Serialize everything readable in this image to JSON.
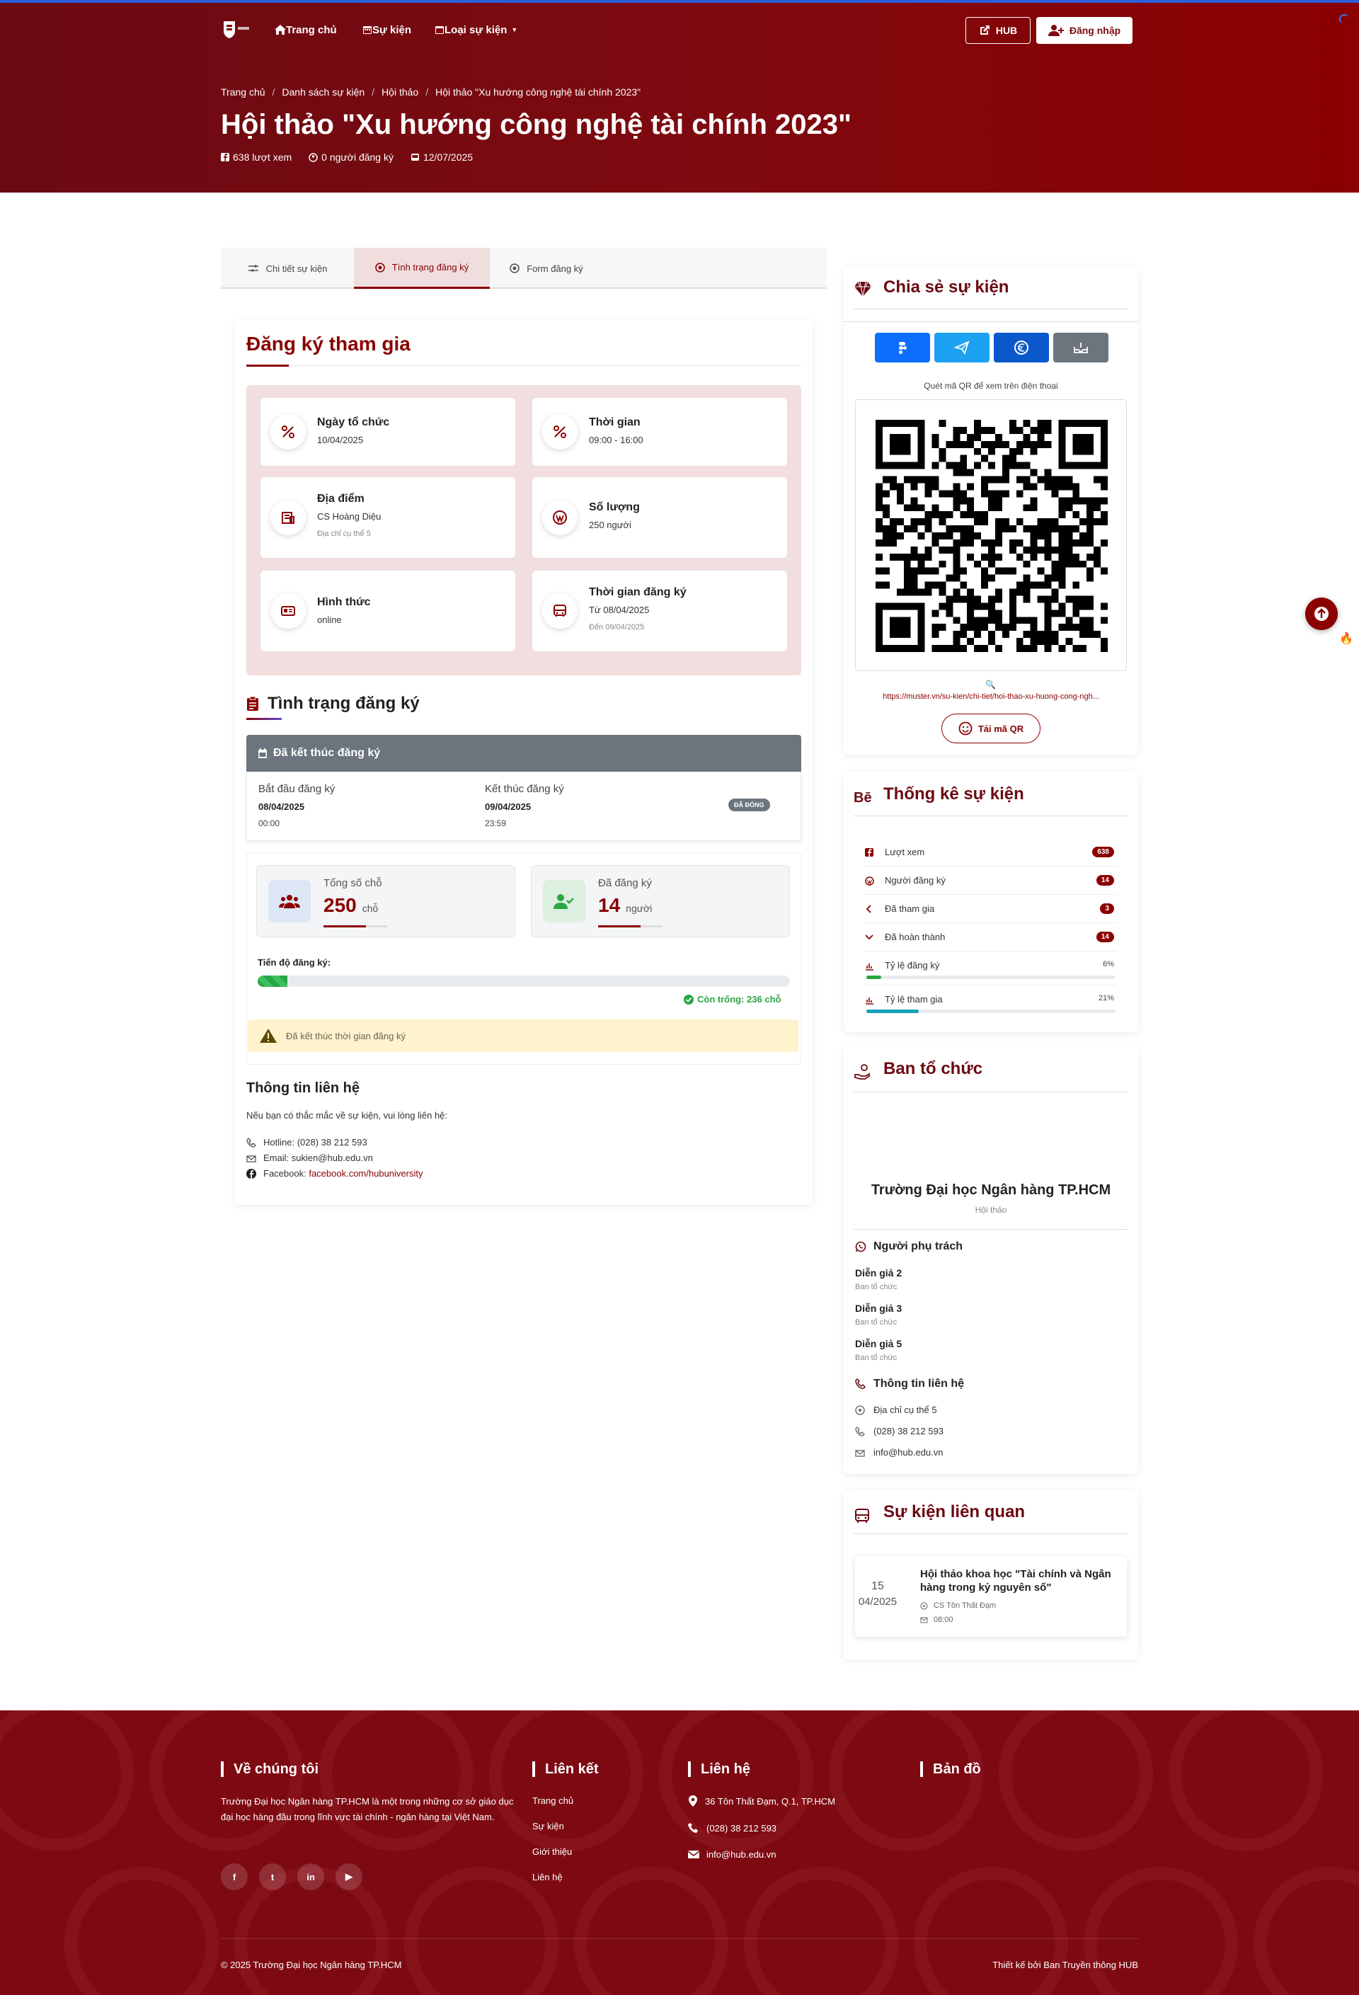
{
  "header": {
    "nav": {
      "home": "Trang chủ",
      "events": "Sự kiện",
      "types": "Loại sự kiện"
    },
    "hub_label": "HUB",
    "login_label": "Đăng nhập",
    "breadcrumb": [
      "Trang chủ",
      "Danh sách sự kiện",
      "Hội thảo",
      "Hội thảo \"Xu hướng công nghệ tài chính 2023\""
    ],
    "title": "Hội thảo \"Xu hướng công nghệ tài chính 2023\"",
    "meta": {
      "views": "638 lượt xem",
      "registered": "0 người đăng ký",
      "date": "12/07/2025"
    }
  },
  "tabs": [
    "Chi tiết sự kiện",
    "Tình trạng đăng ký",
    "Form đăng ký"
  ],
  "register": {
    "title": "Đăng ký tham gia",
    "cards": [
      {
        "title": "Ngày tổ chức",
        "value": "10/04/2025",
        "sub": ""
      },
      {
        "title": "Thời gian",
        "value": "09:00 - 16:00",
        "sub": ""
      },
      {
        "title": "Địa điểm",
        "value": "CS Hoàng Diệu",
        "sub": "Địa chỉ cụ thể 5"
      },
      {
        "title": "Số lượng",
        "value": "250 người",
        "sub": ""
      },
      {
        "title": "Hình thức",
        "value": "online",
        "sub": ""
      },
      {
        "title": "Thời gian đăng ký",
        "value": "Từ 08/04/2025",
        "sub": "Đến 09/04/2025"
      }
    ]
  },
  "status": {
    "title": "Tình trạng đăng ký",
    "header": "Đã kết thúc đăng ký",
    "start_label": "Bắt đầu đăng ký",
    "start_date": "08/04/2025",
    "start_time": "00:00",
    "end_label": "Kết thúc đăng ký",
    "end_date": "09/04/2025",
    "end_time": "23:59",
    "badge": "ĐÃ ĐÓNG",
    "total_label": "Tổng số chỗ",
    "total_value": "250",
    "total_unit": "chỗ",
    "reg_label": "Đã đăng ký",
    "reg_value": "14",
    "reg_unit": "người",
    "progress_label": "Tiến độ đăng ký:",
    "progress_fraction": 0.056,
    "remaining": "Còn trống: 236 chỗ",
    "warning": "Đã kết thúc thời gian đăng ký"
  },
  "contact": {
    "title": "Thông tin liên hệ",
    "intro": "Nếu bạn có thắc mắc về sự kiện, vui lòng liên hệ:",
    "hotline": "Hotline: (028) 38 212 593",
    "email": "Email: sukien@hub.edu.vn",
    "facebook_label": "Facebook: ",
    "facebook_link": "facebook.com/hubuniversity"
  },
  "share": {
    "title": "Chia sẻ sự kiện",
    "qr_caption": "Quét mã QR để xem trên điện thoại",
    "url": "https://muster.vn/su-kien/chi-tiet/hoi-thao-xu-huong-cong-ngh...",
    "download": "Tải mã QR",
    "colors": [
      "#0d6efd",
      "#1da1f2",
      "#0a58ca",
      "#6c757d"
    ]
  },
  "stats": {
    "title": "Thống kê sự kiện",
    "rows": [
      {
        "label": "Lượt xem",
        "value": "638"
      },
      {
        "label": "Người đăng ký",
        "value": "14"
      },
      {
        "label": "Đã tham gia",
        "value": "3"
      },
      {
        "label": "Đã hoàn thành",
        "value": "14"
      }
    ],
    "reg_rate_label": "Tỷ lệ đăng ký",
    "reg_rate": "6%",
    "reg_rate_fraction": 0.06,
    "join_rate_label": "Tỷ lệ tham gia",
    "join_rate": "21%",
    "join_rate_fraction": 0.21
  },
  "organizer": {
    "title": "Ban tổ chức",
    "name": "Trường Đại học Ngân hàng TP.HCM",
    "type": "Hội thảo",
    "people_title": "Người phụ trách",
    "people": [
      {
        "name": "Diễn giả 2",
        "role": "Ban tổ chức"
      },
      {
        "name": "Diễn giả 3",
        "role": "Ban tổ chức"
      },
      {
        "name": "Diễn giả 5",
        "role": "Ban tổ chức"
      }
    ],
    "contact_title": "Thông tin liên hệ",
    "address": "Địa chỉ cụ thể 5",
    "phone": "(028) 38 212 593",
    "email": "info@hub.edu.vn"
  },
  "related": {
    "title": "Sự kiện liên quan",
    "day": "15",
    "month": "04/2025",
    "event_title": "Hội thảo khoa học \"Tài chính và Ngân hàng trong kỷ nguyên số\"",
    "place": "CS Tôn Thất Đạm",
    "time": "08:00"
  },
  "footer": {
    "about_title": "Về chúng tôi",
    "about_text": "Trường Đại học Ngân hàng TP.HCM là một trong những cơ sở giáo dục đại học hàng đầu trong lĩnh vực tài chính - ngân hàng tại Việt Nam.",
    "links_title": "Liên kết",
    "links": [
      "Trang chủ",
      "Sự kiện",
      "Giới thiệu",
      "Liên hệ"
    ],
    "contact_title": "Liên hệ",
    "address": "36 Tôn Thất Đạm, Q.1, TP.HCM",
    "phone": "(028) 38 212 593",
    "email": "info@hub.edu.vn",
    "map_title": "Bản đồ",
    "copyright": "© 2025 Trường Đại học Ngân hàng TP.HCM",
    "credit": "Thiết kế bởi Ban Truyền thông HUB",
    "social": [
      "f",
      "t",
      "in",
      "▶"
    ]
  },
  "colors": {
    "brand": "#8b0000",
    "brand_dark": "#6b0a12",
    "success": "#28a745",
    "info": "#17a2b8"
  }
}
